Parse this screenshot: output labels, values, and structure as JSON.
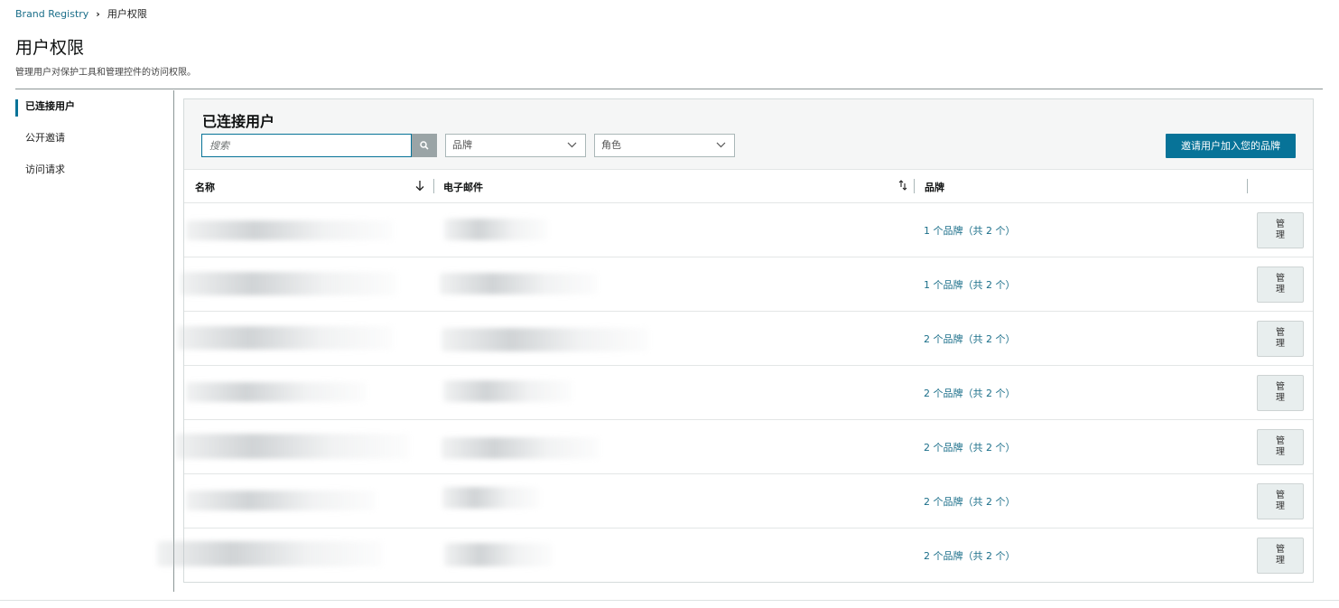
{
  "breadcrumb": {
    "root": "Brand Registry",
    "separator": "›",
    "current": "用户权限"
  },
  "header": {
    "title": "用户权限",
    "subtitle": "管理用户对保护工具和管理控件的访问权限。"
  },
  "sidebar": {
    "items": [
      {
        "label": "已连接用户",
        "active": true
      },
      {
        "label": "公开邀请",
        "active": false
      },
      {
        "label": "访问请求",
        "active": false
      }
    ]
  },
  "panel": {
    "title": "已连接用户",
    "search": {
      "placeholder": "搜索",
      "value": ""
    },
    "brand_filter": {
      "selected": "品牌"
    },
    "role_filter": {
      "selected": "角色"
    },
    "invite_label": "邀请用户加入您的品牌",
    "columns": {
      "name": "名称",
      "email": "电子邮件",
      "brands": "品牌"
    },
    "rows": [
      {
        "brands": "1 个品牌（共 2 个）",
        "action": "管理"
      },
      {
        "brands": "1 个品牌（共 2 个）",
        "action": "管理"
      },
      {
        "brands": "2 个品牌（共 2 个）",
        "action": "管理"
      },
      {
        "brands": "2 个品牌（共 2 个）",
        "action": "管理"
      },
      {
        "brands": "2 个品牌（共 2 个）",
        "action": "管理"
      },
      {
        "brands": "2 个品牌（共 2 个）",
        "action": "管理"
      },
      {
        "brands": "2 个品牌（共 2 个）",
        "action": "管理"
      }
    ]
  },
  "colors": {
    "accent": "#077398",
    "link": "#1a6e89",
    "border": "#d5dbdb"
  },
  "icons": {
    "search": "search-icon",
    "chevron": "chevron-down-icon",
    "sort_desc": "arrow-down-icon",
    "sort_both": "sort-icon"
  }
}
